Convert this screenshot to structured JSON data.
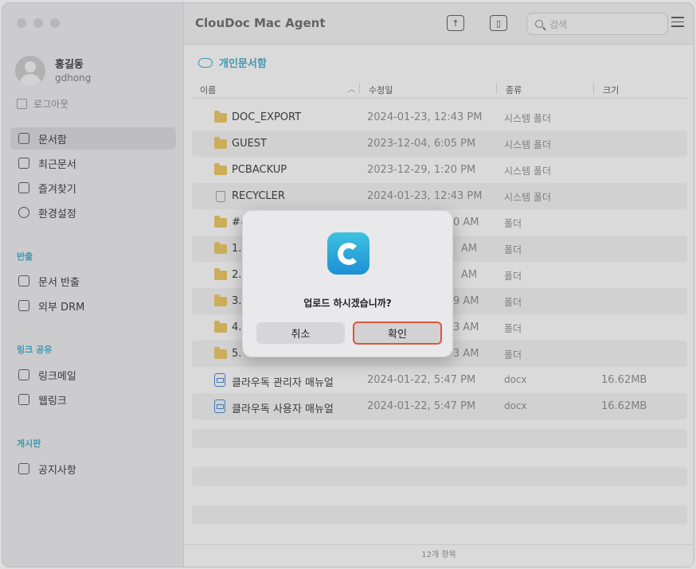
{
  "app": {
    "title": "ClouDoc Mac Agent"
  },
  "user": {
    "name": "홍길동",
    "id": "gdhong",
    "logout": "로그아웃"
  },
  "sidebar": {
    "main": [
      {
        "label": "문서함"
      },
      {
        "label": "최근문서"
      },
      {
        "label": "즐겨찾기"
      },
      {
        "label": "환경설정"
      }
    ],
    "export_title": "반출",
    "export": [
      {
        "label": "문서 반출"
      },
      {
        "label": "외부 DRM"
      }
    ],
    "share_title": "링크 공유",
    "share": [
      {
        "label": "링크메일"
      },
      {
        "label": "웹링크"
      }
    ],
    "board_title": "게시판",
    "board": [
      {
        "label": "공지사항"
      }
    ]
  },
  "toolbar": {
    "search_placeholder": "검색"
  },
  "breadcrumb": "개인문서함",
  "columns": {
    "name": "이름",
    "modified": "수정일",
    "kind": "종류",
    "size": "크기"
  },
  "files": [
    {
      "name": "DOC_EXPORT",
      "date": "2024-01-23, 12:43 PM",
      "kind": "시스템 폴더",
      "size": "",
      "icon": "folder-icon"
    },
    {
      "name": "GUEST",
      "date": "2023-12-04, 6:05 PM",
      "kind": "시스템 폴더",
      "size": "",
      "icon": "folder-icon"
    },
    {
      "name": "PCBACKUP",
      "date": "2023-12-29, 1:20 PM",
      "kind": "시스템 폴더",
      "size": "",
      "icon": "folder-icon"
    },
    {
      "name": "RECYCLER",
      "date": "2024-01-23, 12:43 PM",
      "kind": "시스템 폴더",
      "size": "",
      "icon": "trash-icon"
    },
    {
      "name": "##",
      "date": "0 AM",
      "kind": "폴더",
      "size": "",
      "icon": "folder-icon"
    },
    {
      "name": "1.",
      "date": "AM",
      "kind": "폴더",
      "size": "",
      "icon": "folder-icon"
    },
    {
      "name": "2.",
      "date": "AM",
      "kind": "폴더",
      "size": "",
      "icon": "folder-icon"
    },
    {
      "name": "3.",
      "date": "9 AM",
      "kind": "폴더",
      "size": "",
      "icon": "folder-icon"
    },
    {
      "name": "4.",
      "date": "3 AM",
      "kind": "폴더",
      "size": "",
      "icon": "folder-icon"
    },
    {
      "name": "5.",
      "date": "3 AM",
      "kind": "폴더",
      "size": "",
      "icon": "folder-icon"
    },
    {
      "name": "클라우독 관리자 매뉴얼",
      "date": "2024-01-22, 5:47 PM",
      "kind": "docx",
      "size": "16.62MB",
      "icon": "docx-icon"
    },
    {
      "name": "클라우독 사용자 매뉴얼",
      "date": "2024-01-22, 5:47 PM",
      "kind": "docx",
      "size": "16.62MB",
      "icon": "docx-icon"
    }
  ],
  "status": "12개 항목",
  "dialog": {
    "message": "업로드 하시겠습니까?",
    "cancel": "취소",
    "ok": "확인"
  },
  "colors": {
    "accent": "#3aa7c3",
    "highlight": "#e0553b"
  }
}
